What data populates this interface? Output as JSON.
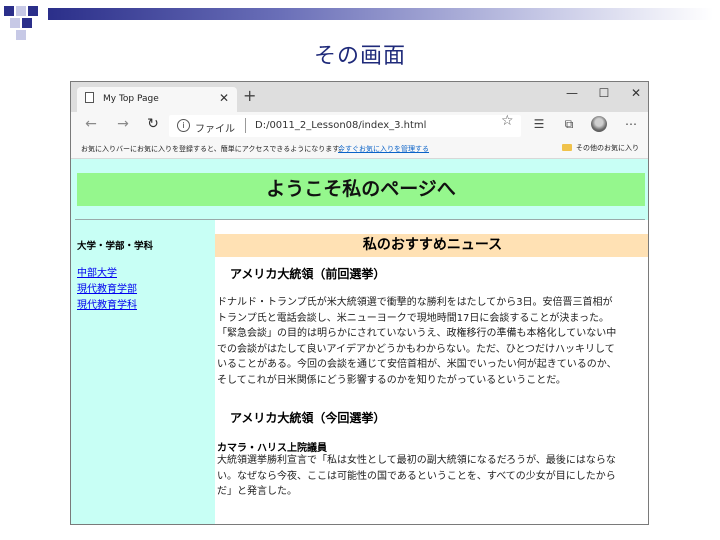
{
  "slide": {
    "title": "その画面",
    "colors": {
      "square": "#2b2f8a",
      "bar_start": "#2b2f8a"
    }
  },
  "browser": {
    "tab": {
      "title": "My Top Page",
      "close": "✕"
    },
    "new_tab": "+",
    "window_controls": {
      "minimize": "—",
      "maximize": "☐",
      "close": "✕"
    },
    "nav": {
      "back": "←",
      "forward": "→",
      "reload": "↻"
    },
    "address": {
      "info": "i",
      "scheme_label": "ファイル",
      "url": "D:/0011_2_Lesson08/index_3.html"
    },
    "icons": {
      "star": "☆",
      "favorites": "☰",
      "collections": "⧉",
      "more": "⋯"
    },
    "favorites_bar": {
      "message": "お気に入りバーにお気に入りを登録すると、簡単にアクセスできるようになります。",
      "manage_link": "今すぐお気に入りを管理する",
      "other_favorites": "その他のお気に入り"
    }
  },
  "page": {
    "banner": "ようこそ私のページへ",
    "sidebar": {
      "heading": "大学・学部・学科",
      "links": [
        "中部大学",
        "現代教育学部",
        "現代教育学科"
      ]
    },
    "main": {
      "title": "私のおすすめニュース",
      "sections": [
        {
          "heading": "アメリカ大統領（前回選挙）",
          "lines": [
            "ドナルド・トランプ氏が米大統領選で衝撃的な勝利をはたしてから3日。安倍晋三首相が",
            "トランプ氏と電話会談し、米ニューヨークで現地時間17日に会談することが決まった。",
            "「緊急会談」の目的は明らかにされていないうえ、政権移行の準備も本格化していない中",
            "での会談がはたして良いアイデアかどうかもわからない。ただ、ひとつだけハッキリして",
            "いることがある。今回の会談を通じて安倍首相が、米国でいったい何が起きているのか、",
            "そしてこれが日米関係にどう影響するのかを知りたがっているということだ。"
          ]
        },
        {
          "heading": "アメリカ大統領（今回選挙）",
          "subheading": "カマラ・ハリス上院議員",
          "lines": [
            "大統領選挙勝利宣言で「私は女性として最初の副大統領になるだろうが、最後にはならな",
            "い。なぜなら今夜、ここは可能性の国であるということを、すべての少女が目にしたから",
            "だ」と発言した。"
          ]
        }
      ]
    },
    "colors": {
      "background": "#c8fff5",
      "banner": "#95f78d",
      "news_title": "#ffe1b4",
      "link": "#0000ee"
    }
  }
}
